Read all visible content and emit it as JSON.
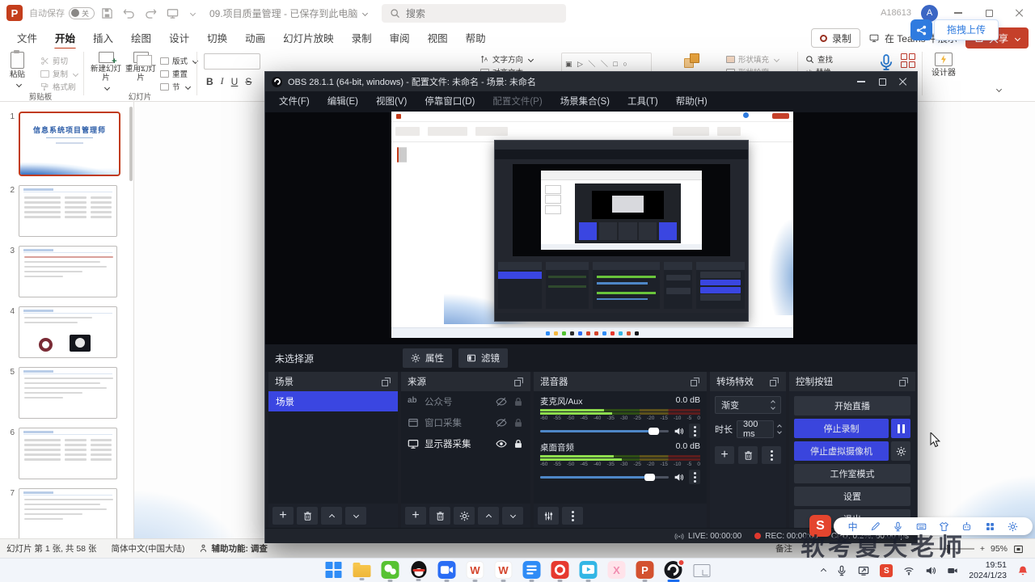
{
  "watermark": "软考夏天老师",
  "ppt": {
    "titlebar": {
      "autosave": "自动保存",
      "autosave_state": "关",
      "title": "09.项目质量管理 - 已保存到此电脑",
      "search": "搜索",
      "user": "A18613",
      "avatar": "A"
    },
    "tabs": [
      "文件",
      "开始",
      "插入",
      "绘图",
      "设计",
      "切换",
      "动画",
      "幻灯片放映",
      "录制",
      "审阅",
      "视图",
      "帮助"
    ],
    "active_tab": "开始",
    "quick": {
      "record": "录制",
      "teams": "在 Teams 中展示",
      "share": "共享",
      "tooltip": "拖拽上传"
    },
    "ribbon": {
      "paste": "粘贴",
      "cut": "剪切",
      "copy": "复制",
      "painter": "格式刷",
      "clipboard_group": "剪贴板",
      "new_slide": "新建幻灯片",
      "reuse_slide": "重用幻灯片",
      "layout": "版式",
      "reset": "重置",
      "section": "节",
      "slides_group": "幻灯片",
      "bold": "B",
      "italic": "I",
      "underline": "U",
      "strike": "S",
      "text_direction": "文字方向",
      "align_text": "对齐文本",
      "shape_fill": "形状填充",
      "shape_outline": "形状轮廓",
      "find": "查找",
      "replace": "替换",
      "designer": "设计器"
    },
    "slides": [
      {
        "num": "1",
        "kind": "title",
        "title": "信息系统项目管理师",
        "selected": true
      },
      {
        "num": "2",
        "kind": "table"
      },
      {
        "num": "3",
        "kind": "text"
      },
      {
        "num": "4",
        "kind": "images"
      },
      {
        "num": "5",
        "kind": "text"
      },
      {
        "num": "6",
        "kind": "table"
      },
      {
        "num": "7",
        "kind": "text"
      }
    ],
    "status": {
      "slide_info": "幻灯片 第 1 张, 共 58 张",
      "language": "简体中文(中国大陆)",
      "accessibility": "辅助功能: 调查",
      "notes": "备注",
      "zoom": "95%"
    }
  },
  "obs": {
    "title": "OBS 28.1.1 (64-bit, windows) - 配置文件: 未命名 - 场景: 未命名",
    "menu": [
      {
        "label": "文件(F)"
      },
      {
        "label": "编辑(E)"
      },
      {
        "label": "视图(V)"
      },
      {
        "label": "停靠窗口(D)"
      },
      {
        "label": "配置文件(P)",
        "dim": true
      },
      {
        "label": "场景集合(S)"
      },
      {
        "label": "工具(T)"
      },
      {
        "label": "帮助(H)"
      }
    ],
    "no_source": "未选择源",
    "properties": "属性",
    "filters": "滤镜",
    "scenes": {
      "title": "场景",
      "items": [
        {
          "name": "场景",
          "selected": true
        }
      ]
    },
    "sources": {
      "title": "来源",
      "items": [
        {
          "name": "公众号",
          "icon": "text",
          "dim": true,
          "visible": false,
          "locked": false
        },
        {
          "name": "窗口采集",
          "icon": "window",
          "dim": true,
          "visible": false,
          "locked": false
        },
        {
          "name": "显示器采集",
          "icon": "display",
          "dim": false,
          "visible": true,
          "locked": true
        }
      ]
    },
    "mixer": {
      "title": "混音器",
      "ticks": [
        "-60",
        "-55",
        "-50",
        "-45",
        "-40",
        "-35",
        "-30",
        "-25",
        "-20",
        "-15",
        "-10",
        "-5",
        "0"
      ],
      "channels": [
        {
          "name": "麦克风/Aux",
          "db": "0.0 dB",
          "level": 0.4,
          "slider": 0.88
        },
        {
          "name": "桌面音频",
          "db": "0.0 dB",
          "level": 0.46,
          "slider": 0.85
        }
      ]
    },
    "transitions": {
      "title": "转场特效",
      "type": "渐变",
      "duration_label": "时长",
      "duration": "300 ms"
    },
    "controls": {
      "title": "控制按钮",
      "start_stream": "开始直播",
      "stop_record": "停止录制",
      "stop_vcam": "停止虚拟摄像机",
      "studio": "工作室模式",
      "settings": "设置",
      "exit": "退出"
    },
    "status": {
      "live": "LIVE: 00:00:00",
      "rec": "REC: 00:00:00",
      "cpu": "CPU: 0.2%, 60.00 fps"
    }
  },
  "sogou": {
    "lang": "中"
  },
  "taskbar": {
    "time": "19:51",
    "date": "2024/1/23",
    "apps": [
      {
        "name": "windows-start",
        "open": false
      },
      {
        "name": "file-explorer",
        "open": true
      },
      {
        "name": "wechat",
        "open": true
      },
      {
        "name": "qq",
        "open": true
      },
      {
        "name": "tencent-meeting",
        "open": true
      },
      {
        "name": "wps-word",
        "open": true
      },
      {
        "name": "wps-ppt",
        "open": true
      },
      {
        "name": "tencent-docs",
        "open": true
      },
      {
        "name": "cctalk",
        "open": true
      },
      {
        "name": "tencent-video",
        "open": true
      },
      {
        "name": "capcut",
        "open": false
      },
      {
        "name": "powerpoint",
        "open": true
      },
      {
        "name": "obs",
        "open": true,
        "active": true,
        "badge": true
      },
      {
        "name": "screen-cast",
        "open": false
      }
    ]
  }
}
